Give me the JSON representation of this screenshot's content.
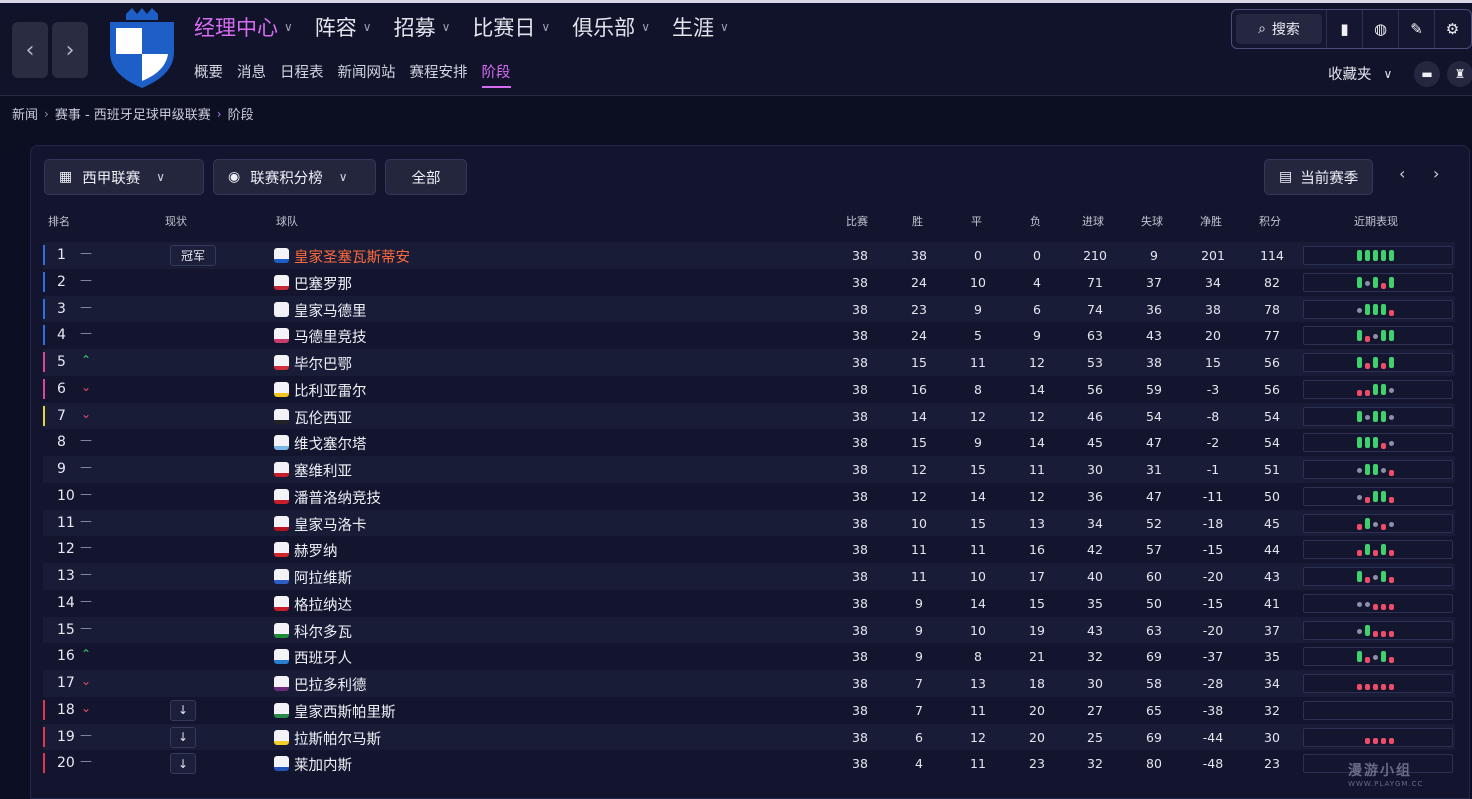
{
  "topnav": {
    "main": [
      {
        "label": "经理中心",
        "active": true
      },
      {
        "label": "阵容",
        "active": false
      },
      {
        "label": "招募",
        "active": false
      },
      {
        "label": "比赛日",
        "active": false
      },
      {
        "label": "俱乐部",
        "active": false
      },
      {
        "label": "生涯",
        "active": false
      }
    ],
    "sub": [
      {
        "label": "概要",
        "active": false
      },
      {
        "label": "消息",
        "active": false
      },
      {
        "label": "日程表",
        "active": false
      },
      {
        "label": "新闻网站",
        "active": false
      },
      {
        "label": "赛程安排",
        "active": false
      },
      {
        "label": "阶段",
        "active": true
      }
    ],
    "search_label": "搜索",
    "favorites_label": "收藏夹"
  },
  "breadcrumb": [
    "新闻",
    "赛事 - 西班牙足球甲级联赛",
    "阶段"
  ],
  "filters": {
    "competition": "西甲联赛",
    "view": "联赛积分榜",
    "scope": "全部",
    "season": "当前赛季"
  },
  "columns": {
    "rank": "排名",
    "status": "现状",
    "team": "球队",
    "played": "比赛",
    "won": "胜",
    "drawn": "平",
    "lost": "负",
    "gf": "进球",
    "ga": "失球",
    "gd": "净胜",
    "pts": "积分",
    "form": "近期表现"
  },
  "colors": {
    "ucl": "#2f6fe0",
    "uel": "#d9459a",
    "uecl": "#e3d736",
    "relegation": "#e0374e",
    "win": "#3ed16c",
    "draw": "#8d90a8",
    "loss": "#ef4c6a",
    "accent": "#d66cf2"
  },
  "rows": [
    {
      "pos": "1",
      "move": "same",
      "status": "冠军",
      "team": "皇家圣塞瓦斯蒂安",
      "highlight": true,
      "zone": "ucl",
      "p": "38",
      "w": "38",
      "d": "0",
      "l": "0",
      "gf": "210",
      "ga": "9",
      "gd": "201",
      "pts": "114",
      "form": [
        "W",
        "W",
        "W",
        "W",
        "W"
      ]
    },
    {
      "pos": "2",
      "move": "same",
      "status": "",
      "team": "巴塞罗那",
      "highlight": false,
      "zone": "ucl",
      "p": "38",
      "w": "24",
      "d": "10",
      "l": "4",
      "gf": "71",
      "ga": "37",
      "gd": "34",
      "pts": "82",
      "form": [
        "W",
        "D",
        "W",
        "L",
        "W"
      ]
    },
    {
      "pos": "3",
      "move": "same",
      "status": "",
      "team": "皇家马德里",
      "highlight": false,
      "zone": "ucl",
      "p": "38",
      "w": "23",
      "d": "9",
      "l": "6",
      "gf": "74",
      "ga": "36",
      "gd": "38",
      "pts": "78",
      "form": [
        "D",
        "W",
        "W",
        "W",
        "L"
      ]
    },
    {
      "pos": "4",
      "move": "same",
      "status": "",
      "team": "马德里竞技",
      "highlight": false,
      "zone": "ucl",
      "p": "38",
      "w": "24",
      "d": "5",
      "l": "9",
      "gf": "63",
      "ga": "43",
      "gd": "20",
      "pts": "77",
      "form": [
        "W",
        "L",
        "D",
        "W",
        "W"
      ]
    },
    {
      "pos": "5",
      "move": "up",
      "status": "",
      "team": "毕尔巴鄂",
      "highlight": false,
      "zone": "uel",
      "p": "38",
      "w": "15",
      "d": "11",
      "l": "12",
      "gf": "53",
      "ga": "38",
      "gd": "15",
      "pts": "56",
      "form": [
        "W",
        "L",
        "W",
        "L",
        "W"
      ]
    },
    {
      "pos": "6",
      "move": "down",
      "status": "",
      "team": "比利亚雷尔",
      "highlight": false,
      "zone": "uel",
      "p": "38",
      "w": "16",
      "d": "8",
      "l": "14",
      "gf": "56",
      "ga": "59",
      "gd": "-3",
      "pts": "56",
      "form": [
        "L",
        "L",
        "W",
        "W",
        "D"
      ]
    },
    {
      "pos": "7",
      "move": "down",
      "status": "",
      "team": "瓦伦西亚",
      "highlight": false,
      "zone": "uecl",
      "p": "38",
      "w": "14",
      "d": "12",
      "l": "12",
      "gf": "46",
      "ga": "54",
      "gd": "-8",
      "pts": "54",
      "form": [
        "W",
        "D",
        "W",
        "W",
        "D"
      ]
    },
    {
      "pos": "8",
      "move": "same",
      "status": "",
      "team": "维戈塞尔塔",
      "highlight": false,
      "zone": "",
      "p": "38",
      "w": "15",
      "d": "9",
      "l": "14",
      "gf": "45",
      "ga": "47",
      "gd": "-2",
      "pts": "54",
      "form": [
        "W",
        "W",
        "W",
        "L",
        "D"
      ]
    },
    {
      "pos": "9",
      "move": "same",
      "status": "",
      "team": "塞维利亚",
      "highlight": false,
      "zone": "",
      "p": "38",
      "w": "12",
      "d": "15",
      "l": "11",
      "gf": "30",
      "ga": "31",
      "gd": "-1",
      "pts": "51",
      "form": [
        "D",
        "W",
        "W",
        "D",
        "L"
      ]
    },
    {
      "pos": "10",
      "move": "same",
      "status": "",
      "team": "潘普洛纳竞技",
      "highlight": false,
      "zone": "",
      "p": "38",
      "w": "12",
      "d": "14",
      "l": "12",
      "gf": "36",
      "ga": "47",
      "gd": "-11",
      "pts": "50",
      "form": [
        "D",
        "L",
        "W",
        "W",
        "L"
      ]
    },
    {
      "pos": "11",
      "move": "same",
      "status": "",
      "team": "皇家马洛卡",
      "highlight": false,
      "zone": "",
      "p": "38",
      "w": "10",
      "d": "15",
      "l": "13",
      "gf": "34",
      "ga": "52",
      "gd": "-18",
      "pts": "45",
      "form": [
        "L",
        "W",
        "D",
        "L",
        "D"
      ]
    },
    {
      "pos": "12",
      "move": "same",
      "status": "",
      "team": "赫罗纳",
      "highlight": false,
      "zone": "",
      "p": "38",
      "w": "11",
      "d": "11",
      "l": "16",
      "gf": "42",
      "ga": "57",
      "gd": "-15",
      "pts": "44",
      "form": [
        "L",
        "W",
        "L",
        "W",
        "L"
      ]
    },
    {
      "pos": "13",
      "move": "same",
      "status": "",
      "team": "阿拉维斯",
      "highlight": false,
      "zone": "",
      "p": "38",
      "w": "11",
      "d": "10",
      "l": "17",
      "gf": "40",
      "ga": "60",
      "gd": "-20",
      "pts": "43",
      "form": [
        "W",
        "L",
        "D",
        "W",
        "L"
      ]
    },
    {
      "pos": "14",
      "move": "same",
      "status": "",
      "team": "格拉纳达",
      "highlight": false,
      "zone": "",
      "p": "38",
      "w": "9",
      "d": "14",
      "l": "15",
      "gf": "35",
      "ga": "50",
      "gd": "-15",
      "pts": "41",
      "form": [
        "D",
        "D",
        "L",
        "L",
        "L"
      ]
    },
    {
      "pos": "15",
      "move": "same",
      "status": "",
      "team": "科尔多瓦",
      "highlight": false,
      "zone": "",
      "p": "38",
      "w": "9",
      "d": "10",
      "l": "19",
      "gf": "43",
      "ga": "63",
      "gd": "-20",
      "pts": "37",
      "form": [
        "D",
        "W",
        "L",
        "L",
        "L"
      ]
    },
    {
      "pos": "16",
      "move": "up",
      "status": "",
      "team": "西班牙人",
      "highlight": false,
      "zone": "",
      "p": "38",
      "w": "9",
      "d": "8",
      "l": "21",
      "gf": "32",
      "ga": "69",
      "gd": "-37",
      "pts": "35",
      "form": [
        "W",
        "L",
        "D",
        "W",
        "L"
      ]
    },
    {
      "pos": "17",
      "move": "down",
      "status": "",
      "team": "巴拉多利德",
      "highlight": false,
      "zone": "",
      "p": "38",
      "w": "7",
      "d": "13",
      "l": "18",
      "gf": "30",
      "ga": "58",
      "gd": "-28",
      "pts": "34",
      "form": [
        "L",
        "L",
        "L",
        "L",
        "L"
      ]
    },
    {
      "pos": "18",
      "move": "down",
      "status": "↓",
      "team": "皇家西斯帕里斯",
      "highlight": false,
      "zone": "relegation",
      "p": "38",
      "w": "7",
      "d": "11",
      "l": "20",
      "gf": "27",
      "ga": "65",
      "gd": "-38",
      "pts": "32",
      "form": [
        "",
        "",
        "",
        "",
        ""
      ]
    },
    {
      "pos": "19",
      "move": "same",
      "status": "↓",
      "team": "拉斯帕尔马斯",
      "highlight": false,
      "zone": "relegation",
      "p": "38",
      "w": "6",
      "d": "12",
      "l": "20",
      "gf": "25",
      "ga": "69",
      "gd": "-44",
      "pts": "30",
      "form": [
        "",
        "L",
        "L",
        "L",
        "L"
      ]
    },
    {
      "pos": "20",
      "move": "same",
      "status": "↓",
      "team": "莱加内斯",
      "highlight": false,
      "zone": "relegation",
      "p": "38",
      "w": "4",
      "d": "11",
      "l": "23",
      "gf": "32",
      "ga": "80",
      "gd": "-48",
      "pts": "23",
      "form": [
        "",
        "",
        "",
        "",
        ""
      ]
    }
  ],
  "watermark": {
    "title": "漫游小组",
    "sub": "WWW.PLAYGM.CC"
  }
}
